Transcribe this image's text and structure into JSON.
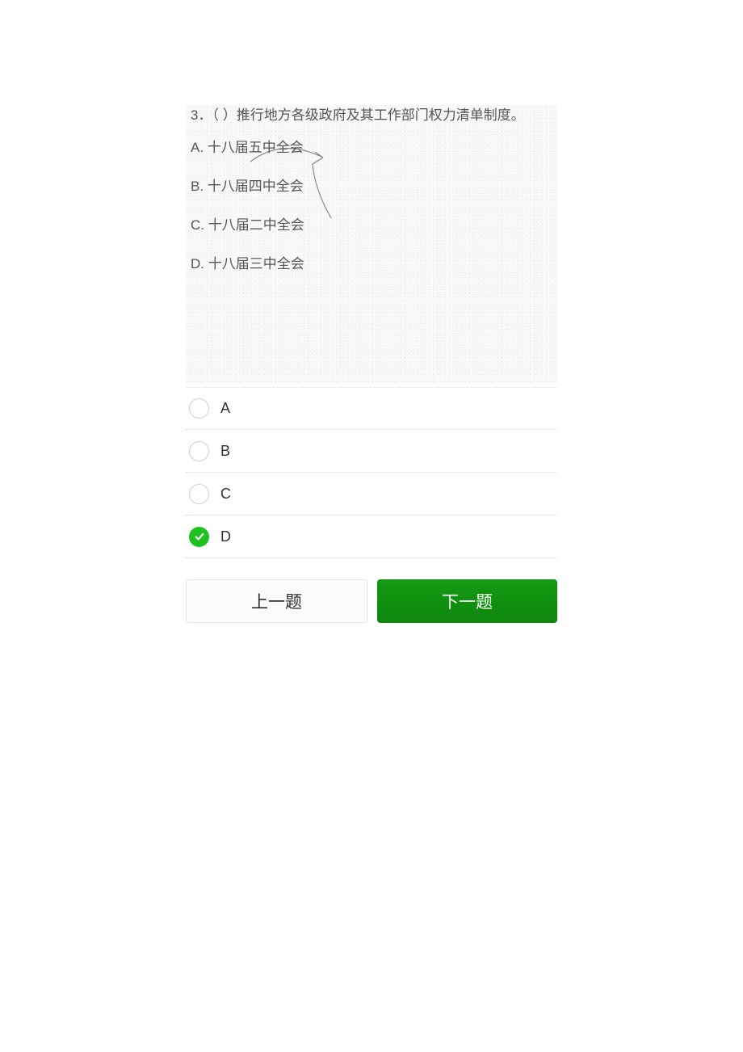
{
  "question": {
    "number": "3．",
    "stem": "（ ）推行地方各级政府及其工作部门权力清单制度。",
    "options": {
      "a_prefix": "A.",
      "a_text": "十八届五中全会",
      "b_prefix": "B.",
      "b_text": "十八届四中全会",
      "c_prefix": "C.",
      "c_text": "十八届二中全会",
      "d_prefix": "D.",
      "d_text": "十八届三中全会"
    }
  },
  "answers": {
    "a": "A",
    "b": "B",
    "c": "C",
    "d": "D",
    "selected": "D"
  },
  "buttons": {
    "prev": "上一题",
    "next": "下一题"
  }
}
